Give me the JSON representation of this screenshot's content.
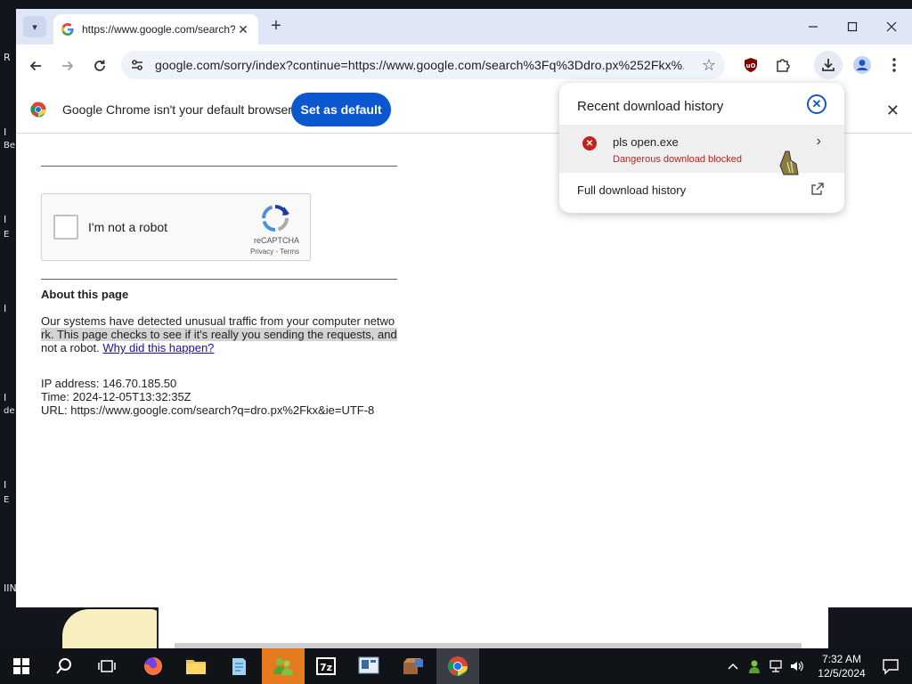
{
  "desktop": {
    "fragments": [
      "R",
      "I",
      "Be",
      "I",
      "E",
      "I",
      "I",
      "de",
      "I",
      "E",
      "IIN"
    ]
  },
  "browser": {
    "tab": {
      "title": "https://www.google.com/search?q=dro.px",
      "favicon": "google-g-icon"
    },
    "window_controls": [
      "minimize",
      "maximize",
      "close"
    ],
    "address_bar": {
      "url": "google.com/sorry/index?continue=https://www.google.com/search%3Fq%3Ddro.px%252Fkx%..."
    },
    "infobar": {
      "message": "Google Chrome isn't your default browser",
      "button": "Set as default"
    }
  },
  "page": {
    "captcha": {
      "label": "I'm not a robot",
      "brand": "reCAPTCHA",
      "terms": "Privacy - Terms"
    },
    "about_heading": "About this page",
    "paragraph": {
      "part1": "Our systems have detected unusual traffic from your computer netwo",
      "part2": "rk. This page checks to see if it's really you sending the requests, and",
      "part3": "not a robot. ",
      "link": "Why did this happen?"
    },
    "ip": "IP address: 146.70.185.50",
    "time": "Time: 2024-12-05T13:32:35Z",
    "url": "URL: https://www.google.com/search?q=dro.px%2Fkx&ie=UTF-8"
  },
  "downloads": {
    "title": "Recent download history",
    "item": {
      "name": "pls open.exe",
      "status": "Dangerous download blocked"
    },
    "full_history": "Full download history"
  },
  "taskbar": {
    "apps": [
      "firefox",
      "file-explorer",
      "notepad",
      "messenger",
      "7zip",
      "remote-desktop",
      "package",
      "chrome"
    ],
    "clock": {
      "time": "7:32 AM",
      "date": "12/5/2024"
    }
  },
  "colors": {
    "accent": "#0b57d0",
    "danger": "#c5221f",
    "tabstrip": "#dfe7f6"
  }
}
